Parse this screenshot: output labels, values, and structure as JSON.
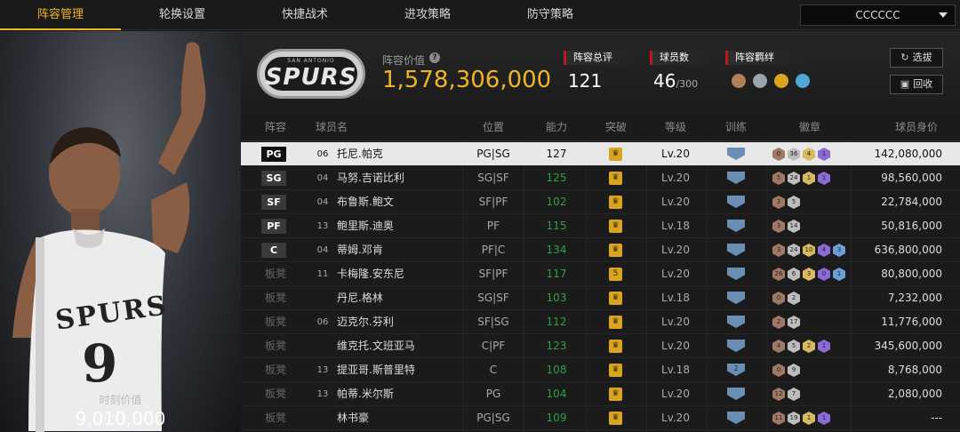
{
  "nav": {
    "tabs": [
      "阵容管理",
      "轮换设置",
      "快捷战术",
      "进攻策略",
      "防守策略"
    ],
    "active_index": 0,
    "team_select": "CCCCCC"
  },
  "left": {
    "value_caption": "时刻价值",
    "value": "9,010,000",
    "jersey": "9",
    "jersey_team": "SPURS"
  },
  "header": {
    "logo_text": "SPURS",
    "logo_sub": "SAN ANTONIO",
    "roster_value_label": "阵容价值",
    "roster_value": "1,578,306,000",
    "overall_label": "阵容总评",
    "overall": "121",
    "players_label": "球员数",
    "players_count": "46",
    "players_max": "/300",
    "bond_label": "阵容羁绊",
    "select_button": "选拔",
    "recycle_button": "回收"
  },
  "table": {
    "headers": [
      "阵容",
      "球员名",
      "位置",
      "能力",
      "突破",
      "等级",
      "训练",
      "徽章",
      "球员身价"
    ],
    "rows": [
      {
        "slot": "PG",
        "num": "06",
        "name": "托尼.帕克",
        "pos": "PG|SG",
        "ability": "127",
        "breakthrough": "",
        "level": "Lv.20",
        "train": "",
        "badges": [
          "0",
          "36",
          "4",
          "1"
        ],
        "price": "142,080,000",
        "selected": true,
        "starter": true
      },
      {
        "slot": "SG",
        "num": "04",
        "name": "马努.吉诺比利",
        "pos": "SG|SF",
        "ability": "125",
        "breakthrough": "",
        "level": "Lv.20",
        "train": "",
        "badges": [
          "5",
          "24",
          "1",
          "1"
        ],
        "price": "98,560,000",
        "selected": false,
        "starter": true
      },
      {
        "slot": "SF",
        "num": "04",
        "name": "布鲁斯.鲍文",
        "pos": "SF|PF",
        "ability": "102",
        "breakthrough": "",
        "level": "Lv.20",
        "train": "",
        "badges": [
          "3",
          "5"
        ],
        "price": "22,784,000",
        "selected": false,
        "starter": true
      },
      {
        "slot": "PF",
        "num": "13",
        "name": "鲍里斯.迪奥",
        "pos": "PF",
        "ability": "115",
        "breakthrough": "",
        "level": "Lv.18",
        "train": "",
        "badges": [
          "3",
          "14"
        ],
        "price": "50,816,000",
        "selected": false,
        "starter": true
      },
      {
        "slot": "C",
        "num": "04",
        "name": "蒂姆.邓肯",
        "pos": "PF|C",
        "ability": "134",
        "breakthrough": "",
        "level": "Lv.20",
        "train": "",
        "badges": [
          "3",
          "24",
          "10",
          "4",
          "3"
        ],
        "price": "636,800,000",
        "selected": false,
        "starter": true
      },
      {
        "slot": "板凳",
        "num": "11",
        "name": "卡梅隆.安东尼",
        "pos": "SF|PF",
        "ability": "117",
        "breakthrough": "5",
        "level": "Lv.20",
        "train": "",
        "badges": [
          "26",
          "6",
          "3",
          "0",
          "1"
        ],
        "price": "80,800,000",
        "selected": false,
        "starter": false
      },
      {
        "slot": "板凳",
        "num": "",
        "name": "丹尼.格林",
        "pos": "SG|SF",
        "ability": "103",
        "breakthrough": "",
        "level": "Lv.18",
        "train": "",
        "badges": [
          "0",
          "2"
        ],
        "price": "7,232,000",
        "selected": false,
        "starter": false
      },
      {
        "slot": "板凳",
        "num": "06",
        "name": "迈克尔.芬利",
        "pos": "SF|SG",
        "ability": "112",
        "breakthrough": "",
        "level": "Lv.20",
        "train": "",
        "badges": [
          "2",
          "17"
        ],
        "price": "11,776,000",
        "selected": false,
        "starter": false
      },
      {
        "slot": "板凳",
        "num": "",
        "name": "维克托.文班亚马",
        "pos": "C|PF",
        "ability": "123",
        "breakthrough": "",
        "level": "Lv.20",
        "train": "",
        "badges": [
          "4",
          "5",
          "2",
          "1"
        ],
        "price": "345,600,000",
        "selected": false,
        "starter": false
      },
      {
        "slot": "板凳",
        "num": "13",
        "name": "提亚哥.斯普里特",
        "pos": "C",
        "ability": "108",
        "breakthrough": "",
        "level": "Lv.18",
        "train": "2",
        "badges": [
          "0",
          "9"
        ],
        "price": "8,768,000",
        "selected": false,
        "starter": false
      },
      {
        "slot": "板凳",
        "num": "13",
        "name": "帕蒂.米尔斯",
        "pos": "PG",
        "ability": "104",
        "breakthrough": "",
        "level": "Lv.20",
        "train": "",
        "badges": [
          "12",
          "7"
        ],
        "price": "2,080,000",
        "selected": false,
        "starter": false
      },
      {
        "slot": "板凳",
        "num": "",
        "name": "林书豪",
        "pos": "PG|SG",
        "ability": "109",
        "breakthrough": "",
        "level": "Lv.20",
        "train": "",
        "badges": [
          "11",
          "19",
          "1",
          "1"
        ],
        "price": "---",
        "selected": false,
        "starter": false
      }
    ]
  },
  "colors": {
    "accent_gold": "#f0b428",
    "green_value": "#2ea043",
    "red_tag": "#c0171a",
    "badge_bronze": "#a07866",
    "badge_silver": "#bdbdbd",
    "badge_gold": "#d8b860",
    "badge_purple": "#8c6bd6",
    "badge_blue": "#6c9fd8"
  }
}
